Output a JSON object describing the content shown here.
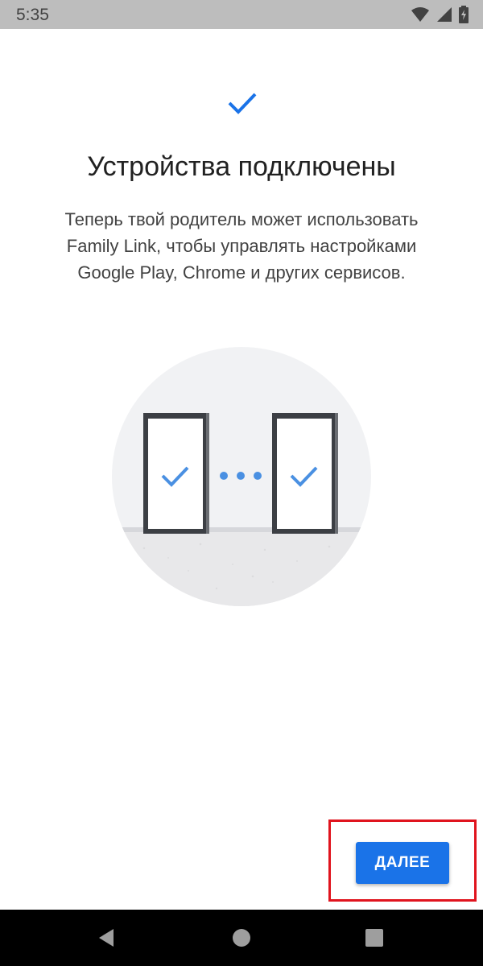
{
  "status_bar": {
    "time": "5:35"
  },
  "screen": {
    "title": "Устройства подключены",
    "description_lines": [
      "Теперь твой родитель может использовать",
      "Family Link, чтобы управлять настройками",
      "Google Play, Chrome и других сервисов."
    ]
  },
  "actions": {
    "next_label": "ДАЛЕЕ"
  },
  "colors": {
    "accent": "#1a73e8",
    "highlight": "#e0141e",
    "check": "#4a90e2"
  },
  "icons": {
    "top": "checkmark-icon",
    "nav": [
      "back-icon",
      "home-icon",
      "recents-icon"
    ],
    "status": [
      "wifi-icon",
      "signal-icon",
      "battery-charging-icon"
    ]
  }
}
